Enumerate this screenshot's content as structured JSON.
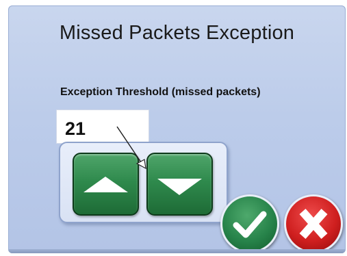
{
  "dialog": {
    "title": "Missed Packets Exception",
    "threshold_label": "Exception Threshold (missed packets)",
    "threshold_value": "21"
  },
  "spinner": {
    "increment_icon": "triangle-up-icon",
    "decrement_icon": "triangle-down-icon"
  },
  "actions": {
    "ok_icon": "checkmark-icon",
    "cancel_icon": "x-icon"
  },
  "colors": {
    "dialog_background": "#bccbe9",
    "spinner_green": "#2f8a4d",
    "ok_green": "#27834a",
    "cancel_red": "#cf1f1f"
  }
}
